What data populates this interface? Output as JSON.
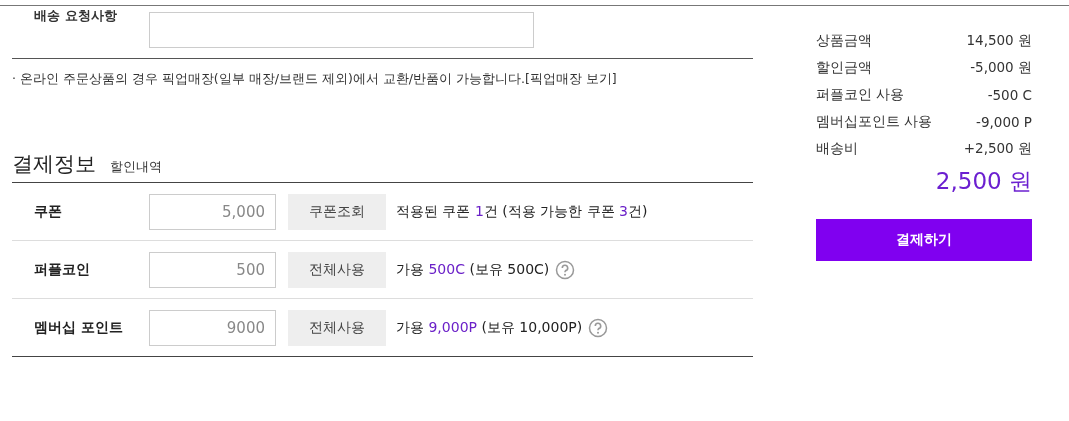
{
  "delivery_request": {
    "label": "배송 요청사항"
  },
  "notice": "· 온라인 주문상품의 경우 픽업매장(일부 매장/브랜드 제외)에서 교환/반품이 가능합니다.[픽업매장 보기]",
  "payment": {
    "title": "결제정보",
    "subtitle": "할인내역",
    "rows": [
      {
        "label": "쿠폰",
        "value": "5,000",
        "button": "쿠폰조회",
        "help": false,
        "info": [
          {
            "text": "적용된 쿠폰 ",
            "highlight": false
          },
          {
            "text": "1",
            "highlight": true
          },
          {
            "text": "건 (적용 가능한 쿠폰 ",
            "highlight": false
          },
          {
            "text": "3",
            "highlight": true
          },
          {
            "text": "건)",
            "highlight": false
          }
        ]
      },
      {
        "label": "퍼플코인",
        "value": "500",
        "button": "전체사용",
        "help": true,
        "info": [
          {
            "text": "가용 ",
            "highlight": false
          },
          {
            "text": "500C",
            "highlight": true
          },
          {
            "text": " (보유 500C)",
            "highlight": false
          }
        ]
      },
      {
        "label": "멤버십 포인트",
        "value": "9000",
        "button": "전체사용",
        "help": true,
        "info": [
          {
            "text": "가용 ",
            "highlight": false
          },
          {
            "text": "9,000P",
            "highlight": true
          },
          {
            "text": " (보유 10,000P)",
            "highlight": false
          }
        ]
      }
    ]
  },
  "summary": {
    "lines": [
      {
        "label": "상품금액",
        "amount": "14,500 원"
      },
      {
        "label": "할인금액",
        "amount": "-5,000 원"
      },
      {
        "label": "퍼플코인 사용",
        "amount": "-500 C"
      },
      {
        "label": "멤버십포인트 사용",
        "amount": "-9,000 P"
      },
      {
        "label": "배송비",
        "amount": "+2,500 원"
      }
    ],
    "total": "2,500 원",
    "pay_button": "결제하기"
  }
}
